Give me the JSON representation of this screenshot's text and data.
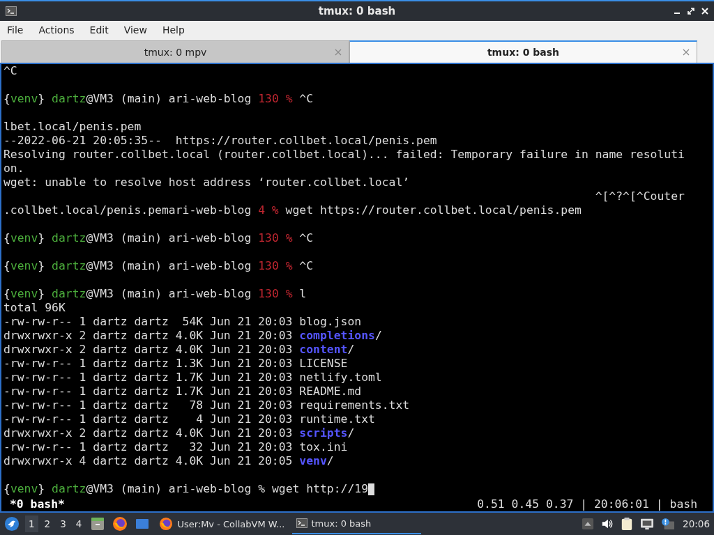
{
  "window": {
    "title": "tmux: 0 bash"
  },
  "menu": [
    "File",
    "Actions",
    "Edit",
    "View",
    "Help"
  ],
  "tabs": [
    {
      "label": "tmux: 0 mpv",
      "selected": false
    },
    {
      "label": "tmux: 0 bash",
      "selected": true
    }
  ],
  "terminal": {
    "cursor": true,
    "lines": [
      {
        "kind": "text",
        "segments": [
          {
            "text": "^C",
            "kind": "plain"
          }
        ]
      },
      {
        "kind": "blank"
      },
      {
        "kind": "text",
        "segments": [
          {
            "text": "{",
            "kind": "plain"
          },
          {
            "text": "venv",
            "kind": "green"
          },
          {
            "text": "} ",
            "kind": "plain"
          },
          {
            "text": "dartz",
            "kind": "green"
          },
          {
            "text": "@VM3 (main) ari-web-blog ",
            "kind": "plain"
          },
          {
            "text": "130 %",
            "kind": "red"
          },
          {
            "text": " ^C",
            "kind": "plain"
          }
        ]
      },
      {
        "kind": "blank"
      },
      {
        "kind": "text",
        "segments": [
          {
            "text": "lbet.local/penis.pem",
            "kind": "plain"
          }
        ]
      },
      {
        "kind": "text",
        "segments": [
          {
            "text": "--2022-06-21 20:05:35--  https://router.collbet.local/penis.pem",
            "kind": "plain"
          }
        ]
      },
      {
        "kind": "text",
        "segments": [
          {
            "text": "Resolving router.collbet.local (router.collbet.local)... failed: Temporary failure in name resoluti",
            "kind": "plain"
          }
        ]
      },
      {
        "kind": "text",
        "segments": [
          {
            "text": "on.",
            "kind": "plain"
          }
        ]
      },
      {
        "kind": "text",
        "segments": [
          {
            "text": "wget: unable to resolve host address ‘router.collbet.local’",
            "kind": "plain"
          }
        ]
      },
      {
        "kind": "right",
        "segments": [
          {
            "text": "^[^?^[^Couter",
            "kind": "plain"
          }
        ]
      },
      {
        "kind": "text",
        "segments": [
          {
            "text": ".collbet.local/penis.pemari-web-blog ",
            "kind": "plain"
          },
          {
            "text": "4 %",
            "kind": "red"
          },
          {
            "text": " wget https://router.collbet.local/penis.pem",
            "kind": "plain"
          }
        ]
      },
      {
        "kind": "blank"
      },
      {
        "kind": "text",
        "segments": [
          {
            "text": "{",
            "kind": "plain"
          },
          {
            "text": "venv",
            "kind": "green"
          },
          {
            "text": "} ",
            "kind": "plain"
          },
          {
            "text": "dartz",
            "kind": "green"
          },
          {
            "text": "@VM3 (main) ari-web-blog ",
            "kind": "plain"
          },
          {
            "text": "130 %",
            "kind": "red"
          },
          {
            "text": " ^C",
            "kind": "plain"
          }
        ]
      },
      {
        "kind": "blank"
      },
      {
        "kind": "text",
        "segments": [
          {
            "text": "{",
            "kind": "plain"
          },
          {
            "text": "venv",
            "kind": "green"
          },
          {
            "text": "} ",
            "kind": "plain"
          },
          {
            "text": "dartz",
            "kind": "green"
          },
          {
            "text": "@VM3 (main) ari-web-blog ",
            "kind": "plain"
          },
          {
            "text": "130 %",
            "kind": "red"
          },
          {
            "text": " ^C",
            "kind": "plain"
          }
        ]
      },
      {
        "kind": "blank"
      },
      {
        "kind": "text",
        "segments": [
          {
            "text": "{",
            "kind": "plain"
          },
          {
            "text": "venv",
            "kind": "green"
          },
          {
            "text": "} ",
            "kind": "plain"
          },
          {
            "text": "dartz",
            "kind": "green"
          },
          {
            "text": "@VM3 (main) ari-web-blog ",
            "kind": "plain"
          },
          {
            "text": "130 %",
            "kind": "red"
          },
          {
            "text": " l",
            "kind": "plain"
          }
        ]
      },
      {
        "kind": "text",
        "segments": [
          {
            "text": "total 96K",
            "kind": "plain"
          }
        ]
      },
      {
        "kind": "text",
        "segments": [
          {
            "text": "-rw-rw-r-- 1 dartz dartz  54K Jun 21 20:03 blog.json",
            "kind": "plain"
          }
        ]
      },
      {
        "kind": "text",
        "segments": [
          {
            "text": "drwxrwxr-x 2 dartz dartz 4.0K Jun 21 20:03 ",
            "kind": "plain"
          },
          {
            "text": "completions",
            "kind": "dir"
          },
          {
            "text": "/",
            "kind": "plain"
          }
        ]
      },
      {
        "kind": "text",
        "segments": [
          {
            "text": "drwxrwxr-x 2 dartz dartz 4.0K Jun 21 20:03 ",
            "kind": "plain"
          },
          {
            "text": "content",
            "kind": "dir"
          },
          {
            "text": "/",
            "kind": "plain"
          }
        ]
      },
      {
        "kind": "text",
        "segments": [
          {
            "text": "-rw-rw-r-- 1 dartz dartz 1.3K Jun 21 20:03 LICENSE",
            "kind": "plain"
          }
        ]
      },
      {
        "kind": "text",
        "segments": [
          {
            "text": "-rw-rw-r-- 1 dartz dartz 1.7K Jun 21 20:03 netlify.toml",
            "kind": "plain"
          }
        ]
      },
      {
        "kind": "text",
        "segments": [
          {
            "text": "-rw-rw-r-- 1 dartz dartz 1.7K Jun 21 20:03 README.md",
            "kind": "plain"
          }
        ]
      },
      {
        "kind": "text",
        "segments": [
          {
            "text": "-rw-rw-r-- 1 dartz dartz   78 Jun 21 20:03 requirements.txt",
            "kind": "plain"
          }
        ]
      },
      {
        "kind": "text",
        "segments": [
          {
            "text": "-rw-rw-r-- 1 dartz dartz    4 Jun 21 20:03 runtime.txt",
            "kind": "plain"
          }
        ]
      },
      {
        "kind": "text",
        "segments": [
          {
            "text": "drwxrwxr-x 2 dartz dartz 4.0K Jun 21 20:03 ",
            "kind": "plain"
          },
          {
            "text": "scripts",
            "kind": "dir"
          },
          {
            "text": "/",
            "kind": "plain"
          }
        ]
      },
      {
        "kind": "text",
        "segments": [
          {
            "text": "-rw-rw-r-- 1 dartz dartz   32 Jun 21 20:03 tox.ini",
            "kind": "plain"
          }
        ]
      },
      {
        "kind": "text",
        "segments": [
          {
            "text": "drwxrwxr-x 4 dartz dartz 4.0K Jun 21 20:05 ",
            "kind": "plain"
          },
          {
            "text": "venv",
            "kind": "dir"
          },
          {
            "text": "/",
            "kind": "plain"
          }
        ]
      },
      {
        "kind": "blank"
      },
      {
        "kind": "text",
        "segments": [
          {
            "text": "{",
            "kind": "plain"
          },
          {
            "text": "venv",
            "kind": "green"
          },
          {
            "text": "} ",
            "kind": "plain"
          },
          {
            "text": "dartz",
            "kind": "green"
          },
          {
            "text": "@VM3 (main) ari-web-blog % wget http://19",
            "kind": "plain"
          }
        ]
      }
    ]
  },
  "tmux_status": {
    "left": "*0 bash*",
    "right": "0.51 0.45 0.37 | 20:06:01 | bash"
  },
  "taskbar": {
    "workspaces": [
      {
        "label": "1",
        "selected": true
      },
      {
        "label": "2",
        "selected": false
      },
      {
        "label": "3",
        "selected": false
      },
      {
        "label": "4",
        "selected": false
      }
    ],
    "windows": [
      {
        "kind": "browser",
        "label": "User:Mv - CollabVM W...",
        "selected": false
      },
      {
        "kind": "terminal",
        "label": "tmux: 0 bash",
        "selected": true
      }
    ],
    "clock": "20:06"
  }
}
